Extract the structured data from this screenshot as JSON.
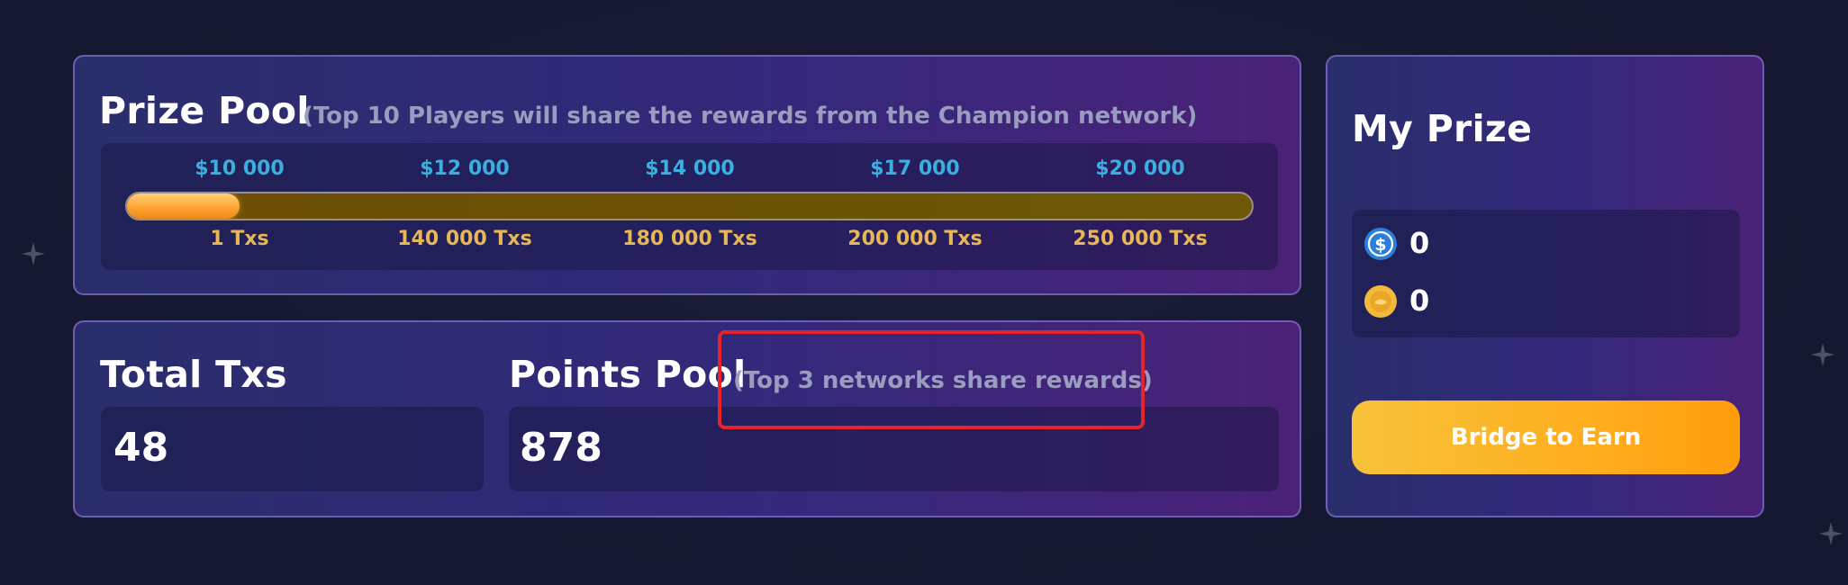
{
  "prize_pool": {
    "title": "Prize Pool",
    "subtitle": "(Top 10 Players will share the rewards from the Champion network)",
    "milestones": [
      {
        "prize": "$10 000",
        "txs": "1 Txs"
      },
      {
        "prize": "$12 000",
        "txs": "140 000 Txs"
      },
      {
        "prize": "$14 000",
        "txs": "180 000 Txs"
      },
      {
        "prize": "$17 000",
        "txs": "200 000 Txs"
      },
      {
        "prize": "$20 000",
        "txs": "250 000 Txs"
      }
    ],
    "progress_fraction": 0.1,
    "colors": {
      "prize_text": "#3ab0e0",
      "txs_text": "#e6b657",
      "progress_fill": "#ffa332"
    }
  },
  "total_txs": {
    "title": "Total Txs",
    "value": "48"
  },
  "points_pool": {
    "title": "Points Pool",
    "subtitle": "(Top 3 networks share rewards)",
    "value": "878"
  },
  "my_prize": {
    "title": "My Prize",
    "rewards": [
      {
        "icon": "usdc-coin-icon",
        "value": "0"
      },
      {
        "icon": "gold-coin-icon",
        "value": "0"
      }
    ],
    "cta_label": "Bridge to Earn",
    "cta_color": "#ffae1f"
  }
}
